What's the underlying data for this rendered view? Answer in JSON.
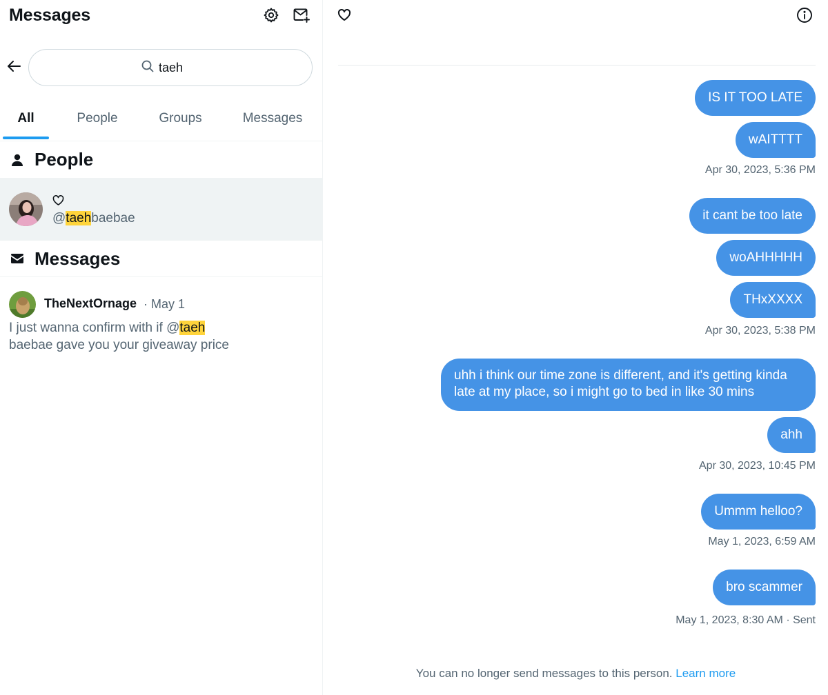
{
  "sidebar": {
    "title": "Messages",
    "settings_icon": "gear-icon",
    "new_message_icon": "new-message-icon",
    "back_icon": "arrow-left-icon",
    "search": {
      "value": "taeh",
      "icon": "search-icon"
    },
    "tabs": [
      {
        "label": "All",
        "active": true
      },
      {
        "label": "People",
        "active": false
      },
      {
        "label": "Groups",
        "active": false
      },
      {
        "label": "Messages",
        "active": false
      }
    ],
    "people_section": {
      "title": "People",
      "icon": "person-icon"
    },
    "person": {
      "display_icon": "heart-icon",
      "handle_prefix": "@",
      "handle_match": "taeh",
      "handle_rest": "baebae"
    },
    "messages_section": {
      "title": "Messages",
      "icon": "envelope-icon"
    },
    "message_result": {
      "name": "TheNextOrnage",
      "date": "· May 1",
      "snippet_before": " I just wanna confirm with if @",
      "snippet_match": "taeh",
      "snippet_after": " baebae gave you your giveaway price"
    }
  },
  "conversation": {
    "header_icon": "heart-icon",
    "info_icon": "info-icon",
    "messages": [
      {
        "text": "IS IT TOO LATE"
      },
      {
        "text": "wAITTTT"
      },
      {
        "timestamp": "Apr 30, 2023, 5:36 PM"
      },
      {
        "text": "it cant be too late"
      },
      {
        "text": "woAHHHHH"
      },
      {
        "text": "THxXXXX"
      },
      {
        "timestamp": "Apr 30, 2023, 5:38 PM"
      },
      {
        "text": "uhh i think our time zone is different, and it's getting kinda late at my place, so i might go to bed in like 30 mins"
      },
      {
        "text": "ahh"
      },
      {
        "timestamp": "Apr 30, 2023, 10:45 PM"
      },
      {
        "text": "Ummm helloo?"
      },
      {
        "timestamp": "May 1, 2023, 6:59 AM"
      },
      {
        "text": "bro scammer"
      },
      {
        "timestamp": "May 1, 2023, 8:30 AM · Sent"
      }
    ],
    "footer_text": "You can no longer send messages to this person.",
    "footer_link": "Learn more"
  },
  "colors": {
    "accent": "#1d9bf0",
    "bubble": "#4593e6",
    "highlight": "#ffd43b",
    "secondary_text": "#536471",
    "selected_row": "#eff3f4"
  }
}
